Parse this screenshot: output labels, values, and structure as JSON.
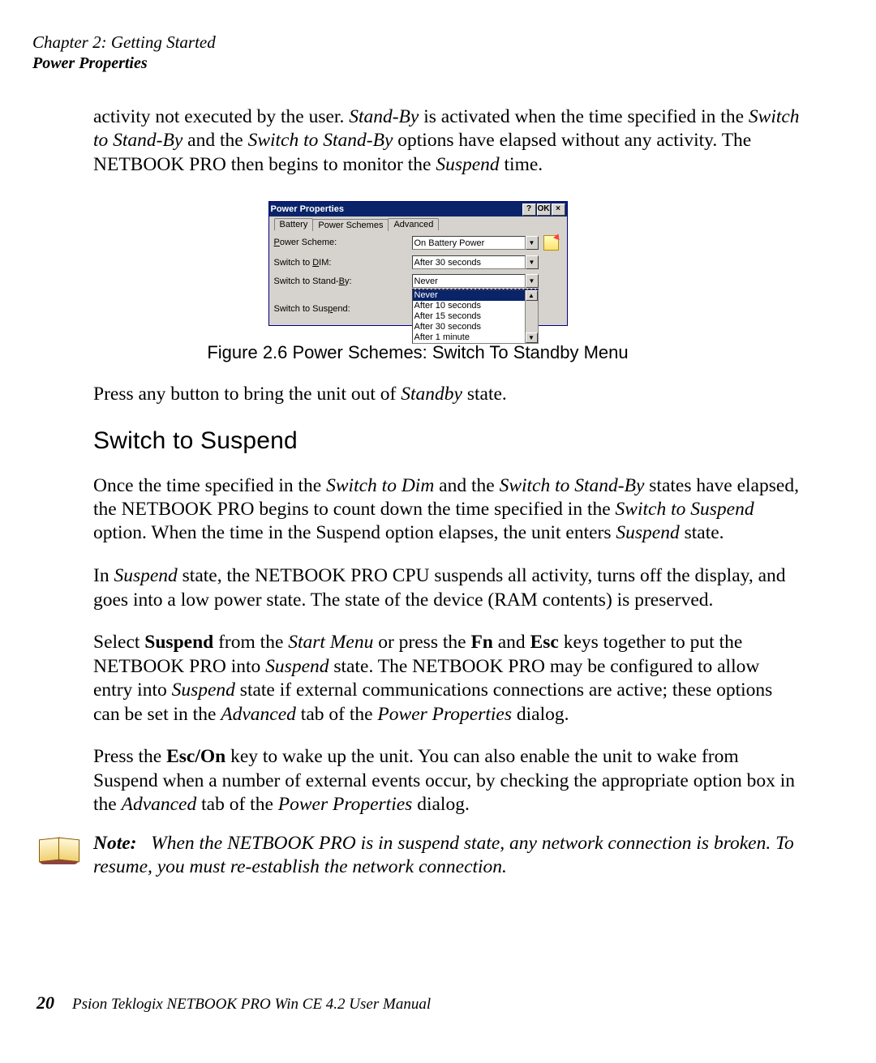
{
  "header": {
    "chapter": "Chapter 2:  Getting Started",
    "section": "Power Properties"
  },
  "para1_before_standby": "activity not executed by the user. ",
  "para1_standby": "Stand-By",
  "para1_mid1": " is activated when the time specified in the ",
  "para1_switch1": "Switch to Stand-By",
  "para1_and": " and the ",
  "para1_switch2": "Switch to Stand-By",
  "para1_mid2": " options have elapsed without any activity. The NETBOOK PRO then begins to monitor the ",
  "para1_suspend": "Suspend",
  "para1_end": " time.",
  "dialog": {
    "title": "Power Properties",
    "help": "?",
    "ok": "OK",
    "close": "×",
    "tabs": [
      "Battery",
      "Power Schemes",
      "Advanced"
    ],
    "active_tab": 1,
    "rows": {
      "scheme_label": "Power Scheme:",
      "scheme_value": "On Battery Power",
      "dim_label": "Switch to DIM:",
      "dim_value": "After 30 seconds",
      "standby_label": "Switch to Stand-By:",
      "standby_value": "Never",
      "suspend_label": "Switch to Suspend:"
    },
    "standby_list": [
      "Never",
      "After 10 seconds",
      "After 15 seconds",
      "After 30 seconds",
      "After 1 minute"
    ],
    "standby_selected": 0
  },
  "figure_caption": "Figure 2.6 Power Schemes: Switch To Standby Menu",
  "para2_a": "Press any button to bring the unit out of ",
  "para2_b": "Standby",
  "para2_c": " state.",
  "h2": "Switch to Suspend",
  "p3_a": "Once the time specified in the ",
  "p3_b": "Switch to Dim",
  "p3_c": " and the ",
  "p3_d": "Switch to Stand-By",
  "p3_e": " states have elapsed, the NETBOOK PRO begins to count down the time specified in the ",
  "p3_f": "Switch to Suspend",
  "p3_g": " option. When the time in the Suspend option elapses, the unit enters ",
  "p3_h": "Suspend",
  "p3_i": " state.",
  "p4_a": "In ",
  "p4_b": "Suspend",
  "p4_c": " state, the NETBOOK PRO CPU suspends all activity, turns off the display, and goes into a low power state. The state of the device (RAM contents) is preserved.",
  "p5_a": "Select ",
  "p5_b": "Suspend",
  "p5_c": " from the ",
  "p5_d": "Start Menu",
  "p5_e": " or press the ",
  "p5_f": "Fn",
  "p5_g": " and ",
  "p5_h": "Esc",
  "p5_i": " keys together to put the NETBOOK PRO into ",
  "p5_j": "Suspend",
  "p5_k": " state. The NETBOOK PRO may be configured to allow entry into ",
  "p5_l": "Suspend",
  "p5_m": " state if external communications connections are active; these options can be set in the ",
  "p5_n": "Advanced",
  "p5_o": " tab of the ",
  "p5_p": "Power Properties",
  "p5_q": " dialog.",
  "p6_a": "Press the ",
  "p6_b": "Esc/On",
  "p6_c": " key to wake up the unit. You can also enable the unit to wake from Suspend when a number of external events occur, by checking the appropriate option box in the ",
  "p6_d": "Advanced",
  "p6_e": " tab of the ",
  "p6_f": "Power Properties",
  "p6_g": " dialog.",
  "note_label": "Note:",
  "note_body": "When the NETBOOK PRO is in suspend state, any network connection is broken. To resume, you must re-establish the network connection.",
  "footer": {
    "page": "20",
    "text": "Psion Teklogix NETBOOK PRO Win CE 4.2 User Manual"
  }
}
